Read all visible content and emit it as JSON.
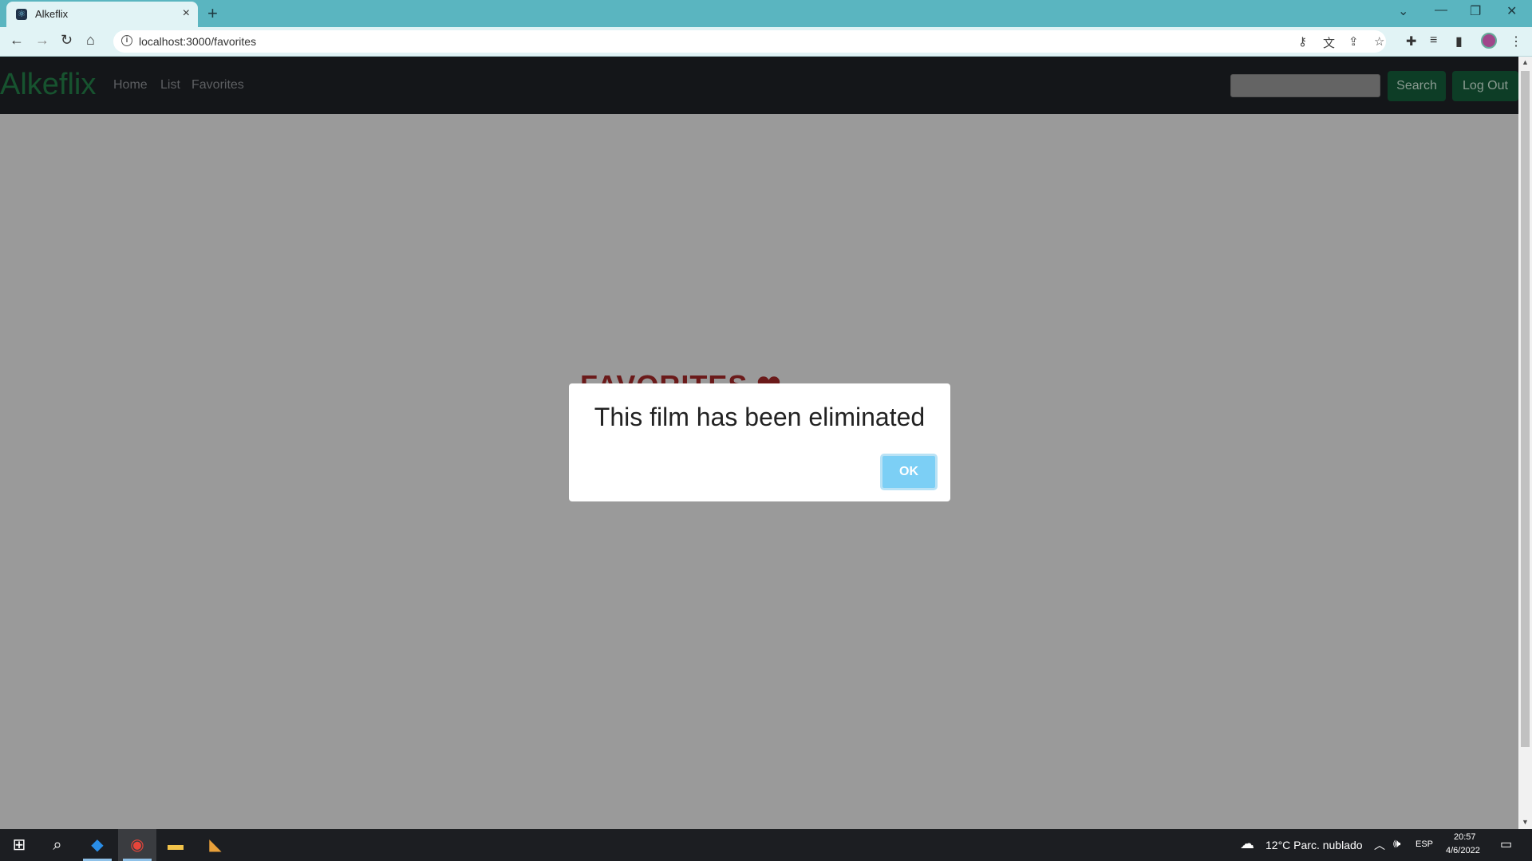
{
  "browser": {
    "tab_title": "Alkeflix",
    "tab_favicon": "react-icon",
    "new_tab_label": "+",
    "url": "localhost:3000/favorites"
  },
  "navbar": {
    "brand": "Alkeflix",
    "links": [
      "Home",
      "List",
      "Favorites"
    ],
    "search_placeholder": "",
    "search_button": "Search",
    "logout_button": "Log Out"
  },
  "page": {
    "background_heading": "FAVORITES ❤"
  },
  "modal": {
    "title": "This film has been eliminated",
    "ok_button": "OK"
  },
  "taskbar": {
    "weather": "12°C  Parc. nublado",
    "language": "ESP",
    "time": "20:57",
    "date": "4/6/2022"
  },
  "colors": {
    "brand": "#17532f",
    "overlay_bg": "#9a9a9a",
    "ok_button": "#7ccff5",
    "tab_strip": "#5ab5c0"
  }
}
